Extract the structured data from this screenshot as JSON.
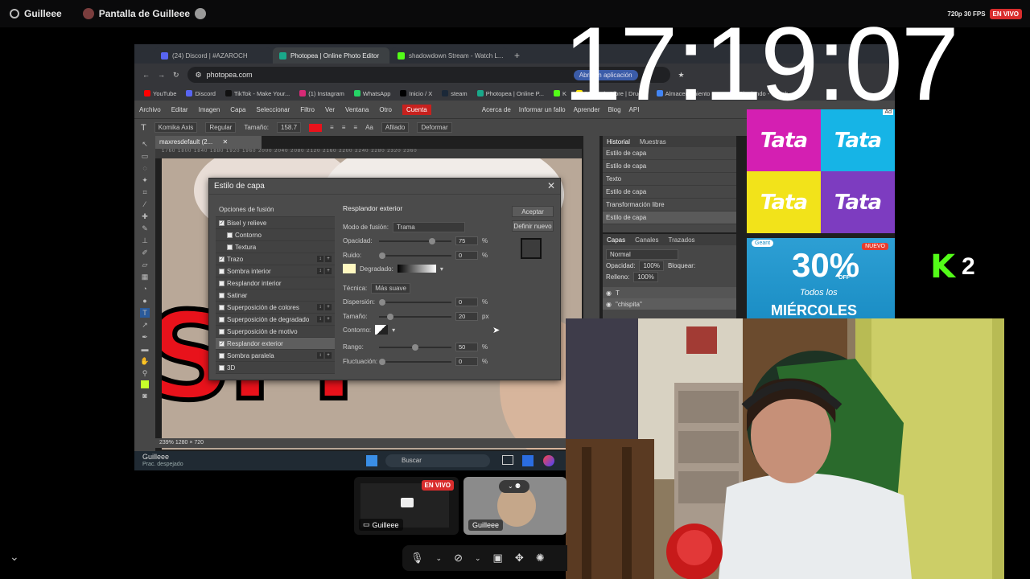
{
  "topbar": {
    "user": "Guilleee",
    "screen_title": "Pantalla de Guilleee",
    "quality": "720p 30 FPS",
    "live_badge": "EN VIVO"
  },
  "clock": "17:19:07",
  "browser": {
    "tabs": [
      {
        "label": "(24) Discord | #AZAROCH",
        "color": "#5865f2"
      },
      {
        "label": "Photopea | Online Photo Editor",
        "color": "#19a88a"
      },
      {
        "label": "shadowdown Stream - Watch L...",
        "color": "#53fc18"
      }
    ],
    "new_tab": "+",
    "url": "photopea.com",
    "open_app": "Abrir en aplicación",
    "bookmarks": [
      {
        "label": "YouTube",
        "color": "#ff0000"
      },
      {
        "label": "Discord",
        "color": "#5865f2"
      },
      {
        "label": "TikTok - Make Your...",
        "color": "#111111"
      },
      {
        "label": "(1) Instagram",
        "color": "#d62976"
      },
      {
        "label": "WhatsApp",
        "color": "#25d366"
      },
      {
        "label": "Inicio / X",
        "color": "#000000"
      },
      {
        "label": "steam",
        "color": "#1b2838"
      },
      {
        "label": "Photopea | Online P...",
        "color": "#19a88a"
      },
      {
        "label": "K",
        "color": "#53fc18"
      },
      {
        "label": "Mercado Libre | Drug...",
        "color": "#ffe600"
      },
      {
        "label": "Almacenamiento - ...",
        "color": "#4285f4"
      },
      {
        "label": "Siguiendo - Twitch",
        "color": "#9146ff"
      }
    ]
  },
  "photopea": {
    "menu": [
      "Archivo",
      "Editar",
      "Imagen",
      "Capa",
      "Seleccionar",
      "Filtro",
      "Ver",
      "Ventana",
      "Otro"
    ],
    "account": "Cuenta",
    "menu_right": [
      "Acerca de",
      "Informar un fallo",
      "Aprender",
      "Blog",
      "API"
    ],
    "toolbar": {
      "font": "Komika Axis",
      "style": "Regular",
      "size_label": "Tamaño:",
      "size": "158.7",
      "aa_label": "Aa",
      "aa": "Afilado",
      "deform": "Deformar"
    },
    "doc_tab": "maxresdefault (2...",
    "ruler": "1760  1800  1840  1880  1920  1960  2000  2040  2080  2120  2160  2200  2240  2280  2320  2360",
    "status": "239%   1280 × 720",
    "history": {
      "tabs": [
        "Historial",
        "Muestras"
      ],
      "items": [
        "Estilo de capa",
        "Estilo de capa",
        "Texto",
        "Estilo de capa",
        "Transformación libre",
        "Estilo de capa"
      ]
    },
    "layers": {
      "tabs": [
        "Capas",
        "Canales",
        "Trazados"
      ],
      "blend": "Normal",
      "opacity_label": "Opacidad:",
      "opacity": "100%",
      "lock_label": "Bloquear:",
      "fill_label": "Relleno:",
      "fill": "100%",
      "rows": [
        "T",
        "\"chispita\""
      ]
    },
    "canvas_text": "ISPI"
  },
  "dialog": {
    "title": "Estilo de capa",
    "section": "Opciones de fusión",
    "effects": [
      {
        "label": "Bisel y relieve",
        "checked": true,
        "indent": false,
        "btns": false
      },
      {
        "label": "Contorno",
        "checked": false,
        "indent": true,
        "btns": false
      },
      {
        "label": "Textura",
        "checked": false,
        "indent": true,
        "btns": false
      },
      {
        "label": "Trazo",
        "checked": true,
        "indent": false,
        "btns": true
      },
      {
        "label": "Sombra interior",
        "checked": false,
        "indent": false,
        "btns": true
      },
      {
        "label": "Resplandor interior",
        "checked": false,
        "indent": false,
        "btns": false
      },
      {
        "label": "Satinar",
        "checked": false,
        "indent": false,
        "btns": false
      },
      {
        "label": "Superposición de colores",
        "checked": false,
        "indent": false,
        "btns": true
      },
      {
        "label": "Superposición de degradado",
        "checked": false,
        "indent": false,
        "btns": true
      },
      {
        "label": "Superposición de motivo",
        "checked": false,
        "indent": false,
        "btns": false
      },
      {
        "label": "Resplandor exterior",
        "checked": true,
        "indent": false,
        "btns": false,
        "active": true
      },
      {
        "label": "Sombra paralela",
        "checked": false,
        "indent": false,
        "btns": true
      },
      {
        "label": "3D",
        "checked": false,
        "indent": false,
        "btns": false
      }
    ],
    "panel_title": "Resplandor exterior",
    "blend_label": "Modo de fusión:",
    "blend_value": "Trama",
    "opacity_label": "Opacidad:",
    "opacity": "75",
    "opacity_frac": 0.75,
    "noise_label": "Ruido:",
    "noise": "0",
    "noise_frac": 0,
    "gradient_label": "Degradado:",
    "glow_color": "#fff8c0",
    "technique_label": "Técnica:",
    "technique": "Más suave",
    "spread_label": "Dispersión:",
    "spread": "0",
    "spread_frac": 0,
    "size_label": "Tamaño:",
    "size": "20",
    "size_unit": "px",
    "size_frac": 0.12,
    "contour_label": "Contorno:",
    "range_label": "Rango:",
    "range": "50",
    "range_frac": 0.5,
    "jitter_label": "Fluctuación:",
    "jitter": "0",
    "jitter_frac": 0,
    "pct": "%",
    "ok": "Aceptar",
    "new_style": "Definir nuevo"
  },
  "taskbar": {
    "user": "Guilleee",
    "status": "Prac. despejado",
    "search": "Buscar"
  },
  "ads": {
    "tata": [
      "Tata",
      "Tata",
      "Tata",
      "Tata"
    ],
    "tata_colors": [
      "#d41fb2",
      "#16b4e6",
      "#f2e31a",
      "#7d3cc0"
    ],
    "ad_badge": "Ad",
    "promo_brand": "Geant",
    "promo_badge": "NUEVO",
    "promo_pct": "30%",
    "promo_off": "OFF",
    "promo_line1": "Todos los",
    "promo_line2": "MIÉRCOLES"
  },
  "kick": {
    "count": "2",
    "color": "#53fc18"
  },
  "tiles": [
    {
      "label": "Guilleee",
      "live": "EN VIVO"
    },
    {
      "label": "Guilleee"
    }
  ],
  "bottom_left": "⌄"
}
